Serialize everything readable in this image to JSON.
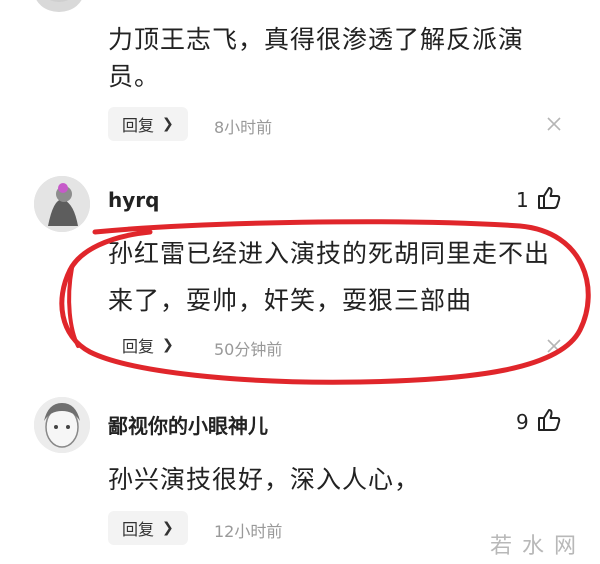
{
  "comments": [
    {
      "text_lines": [
        "力顶王志飞，真得很渗透了解反派演",
        "员。"
      ],
      "reply_label": "回复",
      "time": "8小时前"
    },
    {
      "username": "hyrq",
      "likes": "1",
      "text_lines": [
        "孙红雷已经进入演技的死胡同里走不出",
        "来了，耍帅，奸笑，耍狠三部曲"
      ],
      "reply_label": "回复",
      "time": "50分钟前"
    },
    {
      "username": "鄙视你的小眼神儿",
      "likes": "9",
      "text_lines": [
        "孙兴演技很好，深入人心，"
      ],
      "reply_label": "回复",
      "time": "12小时前"
    }
  ],
  "watermark": "若水网",
  "colors": {
    "annotation_ring": "#e0262b",
    "reply_bg": "#f3f3f3",
    "time_gray": "#999999"
  }
}
